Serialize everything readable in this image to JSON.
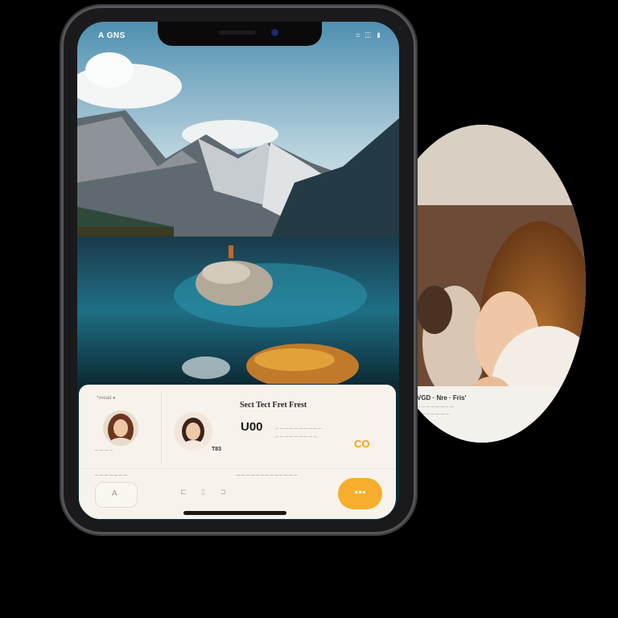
{
  "status_bar": {
    "time": "A GNS",
    "icons": "⌗ ◫ ▮"
  },
  "profile_bubble": {
    "caption_line1": "VGD · Nre · Fris'",
    "caption_line2": "─ ─ ─ ─ ─ ─ ─ ─",
    "caption_line3": "─ ─ ─ ─ ─ ─ ─"
  },
  "card": {
    "top_left_label": "*vvead ●",
    "left_name": "─ ─ ─ ─",
    "title": "Sect Tect Fret Frest",
    "primary_value": "U00",
    "sub_line1": "─ ─ ─ ─ ─ ─ ─ ─ ─ ─",
    "sub_line2": "─ ─ ─ ─ ─ ─ ─ ─ ─",
    "secondary_value": "T83",
    "price": "CO",
    "row_label_left": "─ ─ ─ ─ ─ ─ ─",
    "row_label_mid": "─ ─ ─ ─ ─ ─ ─ ─ ─ ─ ─ ─ ─",
    "ghost_button": "A",
    "mid_icons": "⊏ ▯ ⊐",
    "cta_button": "●●●"
  },
  "colors": {
    "accent": "#f6ae2c",
    "card_bg": "#f7f3ec"
  }
}
